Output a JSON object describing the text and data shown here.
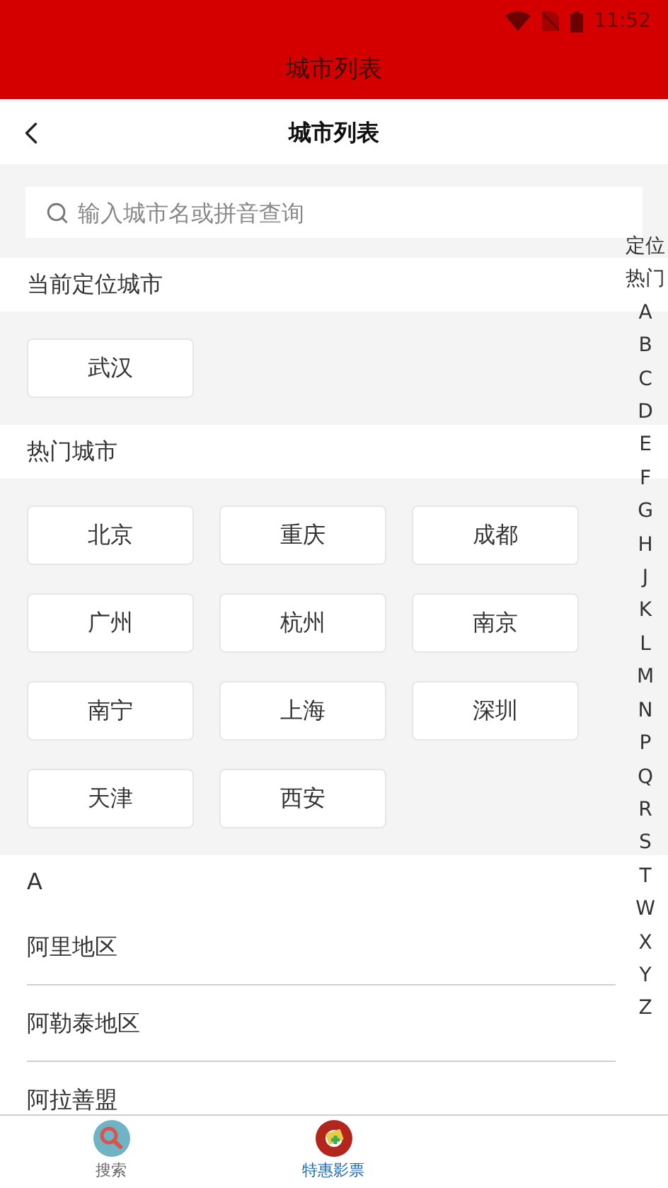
{
  "status_bar": {
    "time": "11:52"
  },
  "app_bar": {
    "title": "城市列表"
  },
  "header": {
    "title": "城市列表"
  },
  "search": {
    "placeholder": "输入城市名或拼音查询"
  },
  "current": {
    "heading": "当前定位城市",
    "city": "武汉"
  },
  "hot": {
    "heading": "热门城市",
    "cities": [
      "北京",
      "重庆",
      "成都",
      "广州",
      "杭州",
      "南京",
      "南宁",
      "上海",
      "深圳",
      "天津",
      "西安"
    ]
  },
  "groups": [
    {
      "letter": "A",
      "cities": [
        "阿里地区",
        "阿勒泰地区",
        "阿拉善盟"
      ]
    }
  ],
  "index": [
    "定位",
    "热门",
    "A",
    "B",
    "C",
    "D",
    "E",
    "F",
    "G",
    "H",
    "J",
    "K",
    "L",
    "M",
    "N",
    "P",
    "Q",
    "R",
    "S",
    "T",
    "W",
    "X",
    "Y",
    "Z"
  ],
  "tabs": [
    {
      "label": "搜索",
      "kind": "search",
      "selected": false
    },
    {
      "label": "特惠影票",
      "kind": "ticket",
      "selected": true
    }
  ]
}
